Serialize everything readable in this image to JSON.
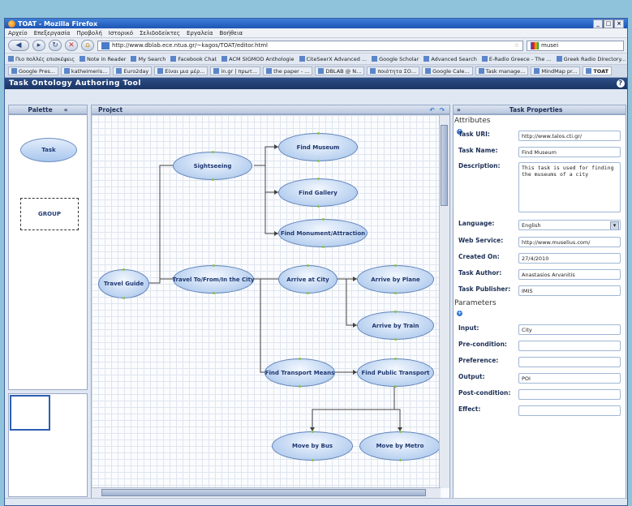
{
  "browser": {
    "title": "TOAT - Mozilla Firefox",
    "menu": [
      "Αρχείο",
      "Επεξεργασία",
      "Προβολή",
      "Ιστορικό",
      "Σελιδοδείκτες",
      "Εργαλεία",
      "Βοήθεια"
    ],
    "url": "http://www.dblab.ece.ntua.gr/~kagos/TOAT/editor.html",
    "search_value": "musei",
    "bookmarks": [
      "Πιο πολλές επισκέψεις",
      "Note in Reader",
      "My Search",
      "Facebook Chat",
      "ACM SIGMOD Anthologie",
      "CiteSeerX Advanced ...",
      "Google Scholar",
      "Advanced Search",
      "E-Radio Greece - The ...",
      "Greek Radio Directory..."
    ],
    "tabs": [
      "Google Pres...",
      "katheimeris...",
      "Euro2day",
      "Είναι μια μέρ...",
      "in.gr | πρωτ...",
      "the paper - ...",
      "DBLAB @ N...",
      "ποιότητα ΣΟ...",
      "Google Cale...",
      "Task manage...",
      "MindMap pr...",
      "TOAT"
    ]
  },
  "app": {
    "title": "Task Ontology Authoring Tool",
    "palette_header": "Palette",
    "project_header": "Project",
    "props_header": "Task Properties",
    "palette_task": "Task",
    "palette_group": "GROUP"
  },
  "nodes": {
    "travel_guide": "Travel Guide",
    "sightseeing": "Sightseeing",
    "find_museum": "Find Museum",
    "find_gallery": "Find Gallery",
    "find_monument": "Find Monument/Attraction",
    "travel_to": "Travel To/From/In the City",
    "arrive_city": "Arrive at City",
    "arrive_plane": "Arrive by Plane",
    "arrive_train": "Arrive by Train",
    "find_transport": "Find Transport Means",
    "find_public": "Find Public Transport",
    "move_bus": "Move by Bus",
    "move_metro": "Move by Metro"
  },
  "properties": {
    "attributes_label": "Attributes",
    "task_uri_label": "Task URI:",
    "task_uri": "http://www.talos.cti.gr/",
    "task_name_label": "Task Name:",
    "task_name": "Find Museum",
    "description_label": "Description:",
    "description": "This task is used for finding the museums of a city",
    "language_label": "Language:",
    "language": "English",
    "web_service_label": "Web Service:",
    "web_service": "http://www.muselius.com/",
    "created_on_label": "Created On:",
    "created_on": "27/4/2010",
    "task_author_label": "Task Author:",
    "task_author": "Anastasios Arvanitis",
    "task_publisher_label": "Task Publisher:",
    "task_publisher": "IMIS",
    "parameters_label": "Parameters",
    "input_label": "Input:",
    "input": "City",
    "precondition_label": "Pre-condition:",
    "precondition": "",
    "preference_label": "Preference:",
    "preference": "",
    "output_label": "Output:",
    "output": "POI",
    "postcondition_label": "Post-condition:",
    "postcondition": "",
    "effect_label": "Effect:",
    "effect": ""
  }
}
